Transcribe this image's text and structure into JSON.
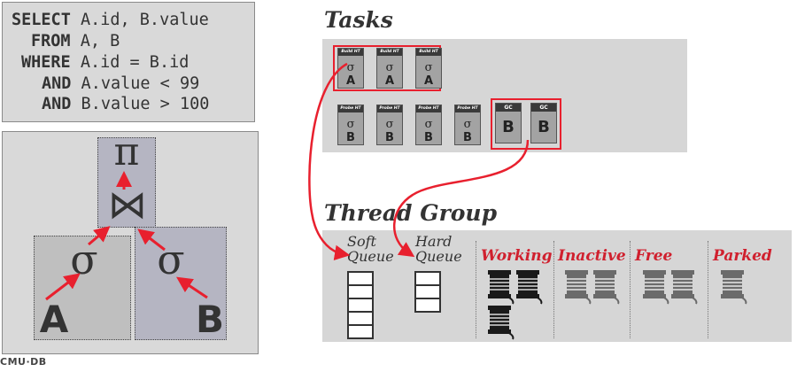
{
  "sql": {
    "lines": [
      {
        "kw": "SELECT",
        "rest": " A.id, B.value"
      },
      {
        "kw": "FROM",
        "rest": " A, B"
      },
      {
        "kw": "WHERE",
        "rest": " A.id = B.id"
      },
      {
        "kw": "AND",
        "rest": " A.value < 99"
      },
      {
        "kw": "AND",
        "rest": " B.value > 100"
      }
    ]
  },
  "plan": {
    "projection": "π",
    "join": "⋈",
    "select_left": "σ",
    "select_right": "σ",
    "table_left": "A",
    "table_right": "B"
  },
  "tasks": {
    "title": "Tasks",
    "build_label": "Build HT",
    "probe_label": "Probe HT",
    "gc_label": "GC",
    "sigma": "σ",
    "build_table": "A",
    "probe_table": "B",
    "gc_table": "B"
  },
  "thread_group": {
    "title": "Thread Group",
    "soft_queue": [
      "Soft",
      "Queue"
    ],
    "hard_queue": [
      "Hard",
      "Queue"
    ],
    "states": [
      "Working",
      "Inactive",
      "Free",
      "Parked"
    ],
    "accent_color": "#d0202e"
  },
  "footer": "CMU·DB"
}
